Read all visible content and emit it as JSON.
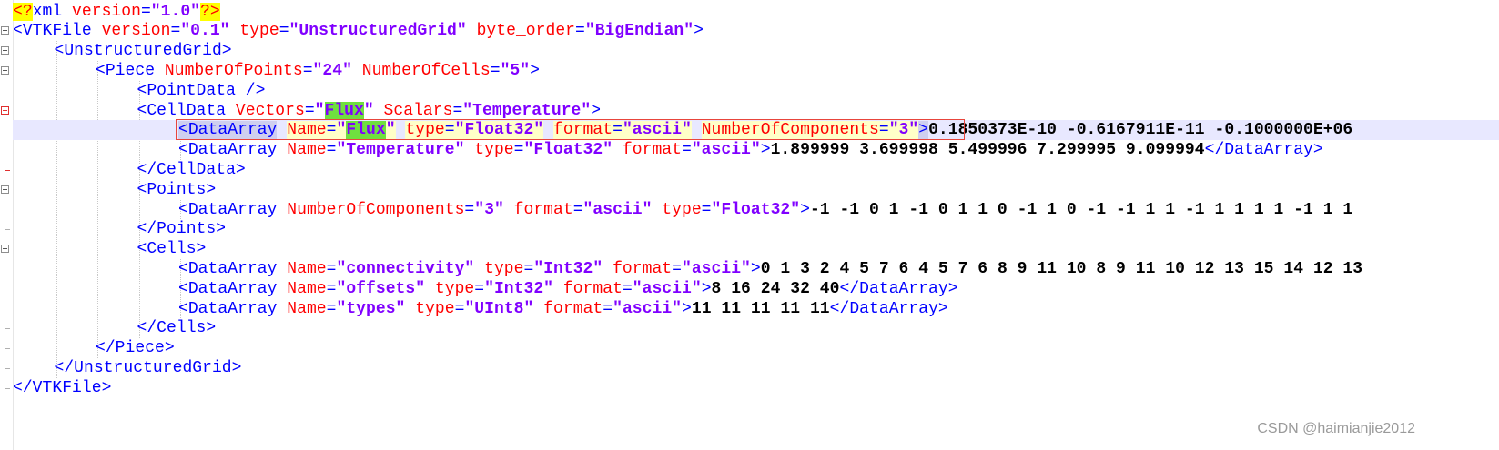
{
  "lines": [
    {
      "segments": [
        [
          "pi",
          "<?"
        ],
        [
          "b",
          "xml"
        ],
        [
          "a",
          " version"
        ],
        [
          "b",
          "="
        ],
        [
          "v",
          "\"1.0\""
        ],
        [
          "pi",
          "?>"
        ]
      ]
    },
    {
      "segments": [
        [
          "b",
          "<VTKFile"
        ],
        [
          "a",
          " version"
        ],
        [
          "b",
          "="
        ],
        [
          "v",
          "\"0.1\""
        ],
        [
          "a",
          " type"
        ],
        [
          "b",
          "="
        ],
        [
          "v",
          "\"UnstructuredGrid\""
        ],
        [
          "a",
          " byte_order"
        ],
        [
          "b",
          "="
        ],
        [
          "v",
          "\"BigEndian\""
        ],
        [
          "b",
          ">"
        ]
      ]
    },
    {
      "segments": [
        [
          "b",
          "<UnstructuredGrid>"
        ]
      ]
    },
    {
      "segments": [
        [
          "b",
          "<Piece"
        ],
        [
          "a",
          " NumberOfPoints"
        ],
        [
          "b",
          "="
        ],
        [
          "v",
          "\"24\""
        ],
        [
          "a",
          " NumberOfCells"
        ],
        [
          "b",
          "="
        ],
        [
          "v",
          "\"5\""
        ],
        [
          "b",
          ">"
        ]
      ]
    },
    {
      "segments": [
        [
          "b",
          "<PointData />"
        ]
      ]
    },
    {
      "segments": [
        [
          "b",
          "<CellData"
        ],
        [
          "a",
          " Vectors"
        ],
        [
          "b",
          "="
        ],
        [
          "v",
          "\""
        ],
        [
          "v hl",
          "Flux"
        ],
        [
          "v",
          "\""
        ],
        [
          "a",
          " Scalars"
        ],
        [
          "b",
          "="
        ],
        [
          "v",
          "\"Temperature\""
        ],
        [
          "b",
          ">"
        ]
      ]
    },
    {
      "segments": [
        [
          "b m",
          "<DataArray"
        ],
        [
          "b",
          " "
        ],
        [
          "a yl",
          "Name"
        ],
        [
          "b yl",
          "="
        ],
        [
          "v yl",
          "\""
        ],
        [
          "v hl",
          "Flux"
        ],
        [
          "v yl",
          "\""
        ],
        [
          "b",
          " "
        ],
        [
          "a yl",
          "type"
        ],
        [
          "b yl",
          "="
        ],
        [
          "v yl",
          "\"Float32\""
        ],
        [
          "b",
          " "
        ],
        [
          "a yl",
          "format"
        ],
        [
          "b yl",
          "="
        ],
        [
          "v yl",
          "\"ascii\""
        ],
        [
          "b",
          " "
        ],
        [
          "a yl",
          "NumberOfComponents"
        ],
        [
          "b yl",
          "="
        ],
        [
          "v yl",
          "\"3\""
        ],
        [
          "b m",
          ">"
        ],
        [
          "t",
          "0.1850373E-10 -0.6167911E-11 -0.1000000E+06"
        ]
      ]
    },
    {
      "segments": [
        [
          "b",
          "<DataArray"
        ],
        [
          "a",
          " Name"
        ],
        [
          "b",
          "="
        ],
        [
          "v",
          "\"Temperature\""
        ],
        [
          "a",
          " type"
        ],
        [
          "b",
          "="
        ],
        [
          "v",
          "\"Float32\""
        ],
        [
          "a",
          " format"
        ],
        [
          "b",
          "="
        ],
        [
          "v",
          "\"ascii\""
        ],
        [
          "b",
          ">"
        ],
        [
          "t",
          "1.899999 3.699998 5.499996 7.299995 9.099994"
        ],
        [
          "b",
          "</DataArray>"
        ]
      ]
    },
    {
      "segments": [
        [
          "b",
          "</CellData>"
        ]
      ]
    },
    {
      "segments": [
        [
          "b",
          "<Points>"
        ]
      ]
    },
    {
      "segments": [
        [
          "b",
          "<DataArray"
        ],
        [
          "a",
          " NumberOfComponents"
        ],
        [
          "b",
          "="
        ],
        [
          "v",
          "\"3\""
        ],
        [
          "a",
          " format"
        ],
        [
          "b",
          "="
        ],
        [
          "v",
          "\"ascii\""
        ],
        [
          "a",
          " type"
        ],
        [
          "b",
          "="
        ],
        [
          "v",
          "\"Float32\""
        ],
        [
          "b",
          ">"
        ],
        [
          "t",
          "-1 -1 0 1 -1 0 1 1 0 -1 1 0 -1 -1 1 1 -1 1 1 1 1 -1 1 1"
        ]
      ]
    },
    {
      "segments": [
        [
          "b",
          "</Points>"
        ]
      ]
    },
    {
      "segments": [
        [
          "b",
          "<Cells>"
        ]
      ]
    },
    {
      "segments": [
        [
          "b",
          "<DataArray"
        ],
        [
          "a",
          " Name"
        ],
        [
          "b",
          "="
        ],
        [
          "v",
          "\"connectivity\""
        ],
        [
          "a",
          " type"
        ],
        [
          "b",
          "="
        ],
        [
          "v",
          "\"Int32\""
        ],
        [
          "a",
          " format"
        ],
        [
          "b",
          "="
        ],
        [
          "v",
          "\"ascii\""
        ],
        [
          "b",
          ">"
        ],
        [
          "t",
          "0 1 3 2 4 5 7 6 4 5 7 6 8 9 11 10 8 9 11 10 12 13 15 14 12 13"
        ]
      ]
    },
    {
      "segments": [
        [
          "b",
          "<DataArray"
        ],
        [
          "a",
          " Name"
        ],
        [
          "b",
          "="
        ],
        [
          "v",
          "\"offsets\""
        ],
        [
          "a",
          " type"
        ],
        [
          "b",
          "="
        ],
        [
          "v",
          "\"Int32\""
        ],
        [
          "a",
          " format"
        ],
        [
          "b",
          "="
        ],
        [
          "v",
          "\"ascii\""
        ],
        [
          "b",
          ">"
        ],
        [
          "t",
          "8 16 24 32 40"
        ],
        [
          "b",
          "</DataArray>"
        ]
      ]
    },
    {
      "segments": [
        [
          "b",
          "<DataArray"
        ],
        [
          "a",
          " Name"
        ],
        [
          "b",
          "="
        ],
        [
          "v",
          "\"types\""
        ],
        [
          "a",
          " type"
        ],
        [
          "b",
          "="
        ],
        [
          "v",
          "\"UInt8\""
        ],
        [
          "a",
          " format"
        ],
        [
          "b",
          "="
        ],
        [
          "v",
          "\"ascii\""
        ],
        [
          "b",
          ">"
        ],
        [
          "t",
          "11 11 11 11 11"
        ],
        [
          "b",
          "</DataArray>"
        ]
      ]
    },
    {
      "segments": [
        [
          "b",
          "</Cells>"
        ]
      ]
    },
    {
      "segments": [
        [
          "b",
          "</Piece>"
        ]
      ]
    },
    {
      "segments": [
        [
          "b",
          "</UnstructuredGrid>"
        ]
      ]
    },
    {
      "segments": [
        [
          "b",
          "</VTKFile>"
        ]
      ]
    }
  ],
  "watermark": "CSDN @haimianjie2012"
}
